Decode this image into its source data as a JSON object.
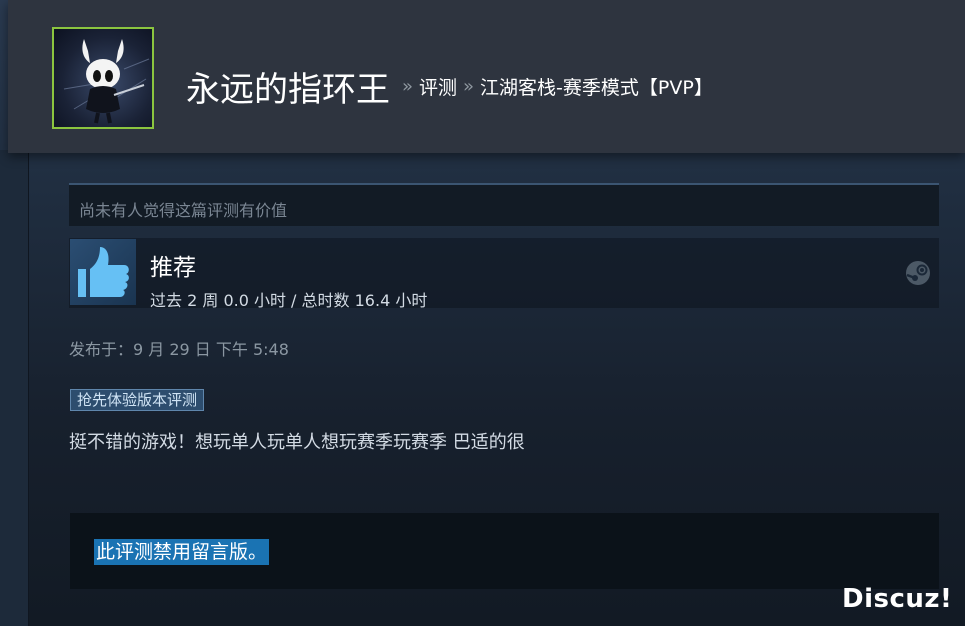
{
  "header": {
    "game_title": "永远的指环王",
    "sep1": "»",
    "crumb_reviews": "评测",
    "sep2": "»",
    "crumb_user": "江湖客栈-赛季模式【PVP】"
  },
  "helpful": {
    "text": "尚未有人觉得这篇评测有价值"
  },
  "recommendation": {
    "label": "推荐",
    "hours": "过去 2 周 0.0 小时 / 总时数 16.4 小时",
    "icon": "thumbs-up-icon"
  },
  "posted": {
    "text": "发布于：9 月 29 日 下午 5:48"
  },
  "early_access_tag": "抢先体验版本评测",
  "review_text": "挺不错的游戏！想玩单人玩单人想玩赛季玩赛季 巴适的很",
  "comments": {
    "disabled_text": "此评测禁用留言版。"
  },
  "watermark": "Discuz!",
  "colors": {
    "avatar_border": "#8bc53f",
    "highlight": "#1a73b3",
    "tag_bg": "#2d4d6e"
  }
}
